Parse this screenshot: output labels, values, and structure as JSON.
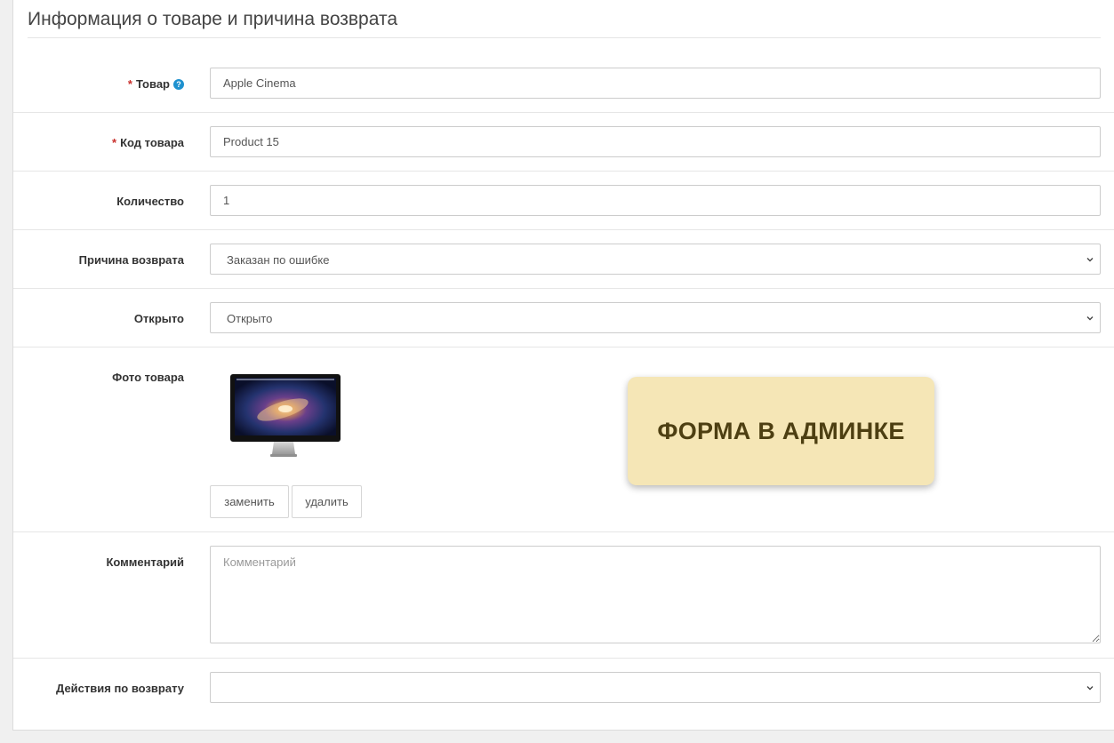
{
  "section": {
    "title": "Информация о товаре и причина возврата"
  },
  "fields": {
    "product": {
      "label": "Товар",
      "required_mark": "*",
      "help_icon": "question-circle-icon",
      "value": "Apple Cinema"
    },
    "model": {
      "label": "Код товара",
      "required_mark": "*",
      "value": "Product 15"
    },
    "quantity": {
      "label": "Количество",
      "value": "1"
    },
    "reason": {
      "label": "Причина возврата",
      "selected": "Заказан по ошибке"
    },
    "opened": {
      "label": "Открыто",
      "selected": "Открыто"
    },
    "photo": {
      "label": "Фото товара",
      "image": "apple-cinema-monitor",
      "replace_label": "заменить",
      "delete_label": "удалить"
    },
    "comment": {
      "label": "Комментарий",
      "placeholder": "Комментарий",
      "value": ""
    },
    "action": {
      "label": "Действия по возврату",
      "selected": ""
    }
  },
  "sticker": {
    "text": "ФОРМА В АДМИНКЕ"
  },
  "colors": {
    "required": "#c9302c",
    "help": "#1e91cf",
    "sticker_bg": "#f5e6b6",
    "sticker_text": "#4d3f12"
  }
}
